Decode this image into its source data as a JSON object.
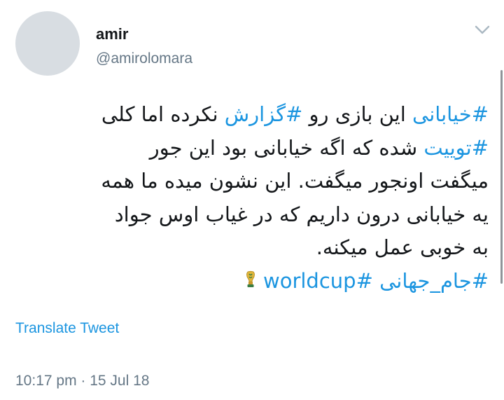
{
  "user": {
    "name": "amir",
    "handle": "@amirolomara"
  },
  "tweet": {
    "lines": [
      [
        {
          "type": "hashtag",
          "text": "#خیابانی"
        },
        {
          "type": "text",
          "text": " این بازی رو "
        },
        {
          "type": "hashtag",
          "text": "#گزارش"
        },
        {
          "type": "text",
          "text": " نکرده اما کلی"
        }
      ],
      [
        {
          "type": "hashtag",
          "text": "#توییت"
        },
        {
          "type": "text",
          "text": " شده که اگه خیابانی بود این جور"
        }
      ],
      [
        {
          "type": "text",
          "text": "میگفت اونجور میگفت. این نشون میده ما همه"
        }
      ],
      [
        {
          "type": "text",
          "text": "یه خیابانی درون داریم که در غیاب اوس جواد"
        }
      ],
      [
        {
          "type": "text",
          "text": "به خوبی عمل میکنه."
        }
      ],
      [
        {
          "type": "hashtag",
          "text": "#جام_جهانی"
        },
        {
          "type": "text",
          "text": " "
        },
        {
          "type": "hashtag",
          "text": "#worldcup"
        },
        {
          "type": "icon",
          "icon": "world-cup-trophy-icon"
        }
      ]
    ]
  },
  "translate_label": "Translate Tweet",
  "timestamp": {
    "time": "10:17 pm",
    "separator": " · ",
    "date": "15 Jul 18"
  },
  "icons": {
    "menu": "chevron-down-icon",
    "emoji": "world-cup-trophy-icon"
  },
  "colors": {
    "hashtag": "#1b95e0",
    "text": "#14171a",
    "secondary": "#657786",
    "avatar_placeholder": "#d8dde2"
  }
}
